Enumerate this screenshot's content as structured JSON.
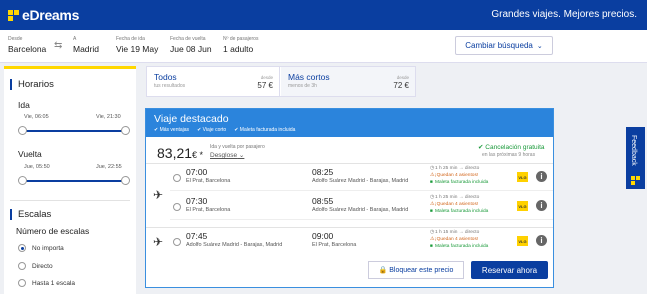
{
  "header": {
    "logo_text": "eDreams",
    "tagline": "Grandes viajes. Mejores precios."
  },
  "search": {
    "from_label": "Desde",
    "from_value": "Barcelona",
    "to_label": "A",
    "to_value": "Madrid",
    "depart_label": "Fecha de ida",
    "depart_value": "Vie 19 May",
    "return_label": "Fecha de vuelta",
    "return_value": "Jue 08 Jun",
    "pax_label": "Nº de pasajeros",
    "pax_value": "1 adulto",
    "change_label": "Cambiar búsqueda"
  },
  "sidebar": {
    "schedules_title": "Horarios",
    "outbound_label": "Ida",
    "outbound_from": "Vie, 06:05",
    "outbound_to": "Vie, 21:30",
    "return_label": "Vuelta",
    "return_from": "Jue, 05:50",
    "return_to": "Jue, 22:55",
    "stops_title": "Escalas",
    "stops_sub": "Número de escalas",
    "stops_options": [
      "No importa",
      "Directo",
      "Hasta 1 escala"
    ]
  },
  "sort": {
    "all": {
      "title": "Todos",
      "sub": "tus resultados",
      "from": "desde",
      "price": "57 €"
    },
    "short": {
      "title": "Más cortos",
      "sub": "menos de 3h",
      "from": "desde",
      "price": "72 €"
    }
  },
  "featured": {
    "title": "Viaje destacado",
    "bullets": [
      "Más ventajas",
      "Viaje corto",
      "Maleta facturada incluida"
    ],
    "price_main": "83,21",
    "price_suffix": "€ *",
    "price_note": "Ida y vuelta por pasajero",
    "breakdown": "Desglose",
    "cancel": "Cancelación gratuita",
    "cancel_sub": "en las próximas 9 horas",
    "outbound": [
      {
        "dep_time": "07:00",
        "dep_airport": "El Prat, Barcelona",
        "arr_time": "08:25",
        "arr_airport": "Adolfo Suárez Madrid - Barajas, Madrid",
        "duration": "1 h 25 min",
        "stop": "directo",
        "seats": "¡Quedan 4 asientos!",
        "bag": "Maleta facturada incluida",
        "airline": "VLG"
      },
      {
        "dep_time": "07:30",
        "dep_airport": "El Prat, Barcelona",
        "arr_time": "08:55",
        "arr_airport": "Adolfo Suárez Madrid - Barajas, Madrid",
        "duration": "1 h 25 min",
        "stop": "directo",
        "seats": "¡Quedan 4 asientos!",
        "bag": "Maleta facturada incluida",
        "airline": "VLG"
      }
    ],
    "inbound": [
      {
        "dep_time": "07:45",
        "dep_airport": "Adolfo Suárez Madrid - Barajas, Madrid",
        "arr_time": "09:00",
        "arr_airport": "El Prat, Barcelona",
        "duration": "1 h 15 min",
        "stop": "directo",
        "seats": "¡Quedan 4 asientos!",
        "bag": "Maleta facturada incluida",
        "airline": "VLG"
      }
    ],
    "lock_label": "Bloquear este precio",
    "book_label": "Reservar ahora"
  },
  "feedback_label": "Feedback",
  "colors": {
    "brand": "#0a3ea0",
    "accent": "#ffd700",
    "featured": "#2b84dc"
  }
}
